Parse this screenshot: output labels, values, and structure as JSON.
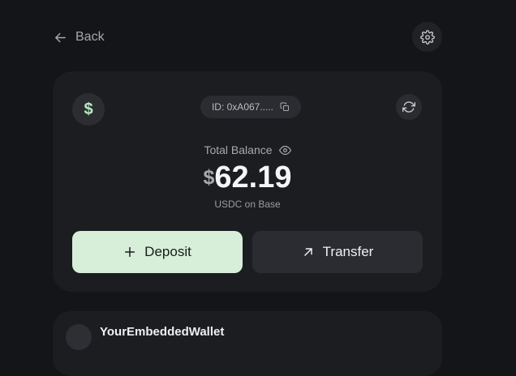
{
  "header": {
    "back_label": "Back",
    "back_icon": "arrow-left-icon",
    "settings_icon": "gear-icon"
  },
  "balance_card": {
    "currency_symbol": "$",
    "wallet_id": "ID: 0xA067.....",
    "copy_icon": "copy-icon",
    "refresh_icon": "refresh-icon",
    "total_label": "Total Balance",
    "visibility_icon": "eye-icon",
    "balance_prefix": "$",
    "balance_value": "62.19",
    "balance_caption": "USDC on Base",
    "deposit_label": "Deposit",
    "transfer_label": "Transfer"
  },
  "wallet_card": {
    "name": "YourEmbeddedWallet"
  },
  "colors": {
    "background": "#141518",
    "card": "#1c1d21",
    "deposit_button": "#d7efd9",
    "accent_green": "#b7eac5"
  }
}
